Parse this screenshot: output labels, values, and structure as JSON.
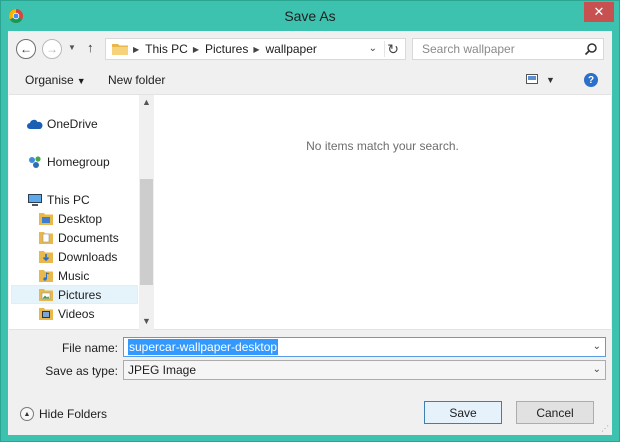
{
  "window": {
    "title": "Save As",
    "close_glyph": "✕"
  },
  "address": {
    "crumbs": [
      "This PC",
      "Pictures",
      "wallpaper"
    ],
    "search_placeholder": "Search wallpaper"
  },
  "toolbar": {
    "organise_label": "Organise",
    "new_folder_label": "New folder"
  },
  "nav": {
    "items": [
      {
        "label": "OneDrive",
        "icon": "cloud-icon"
      },
      {
        "label": "Homegroup",
        "icon": "homegroup-icon"
      },
      {
        "label": "This PC",
        "icon": "computer-icon"
      },
      {
        "label": "Desktop",
        "icon": "desktop-folder-icon"
      },
      {
        "label": "Documents",
        "icon": "documents-folder-icon"
      },
      {
        "label": "Downloads",
        "icon": "downloads-folder-icon"
      },
      {
        "label": "Music",
        "icon": "music-folder-icon"
      },
      {
        "label": "Pictures",
        "icon": "pictures-folder-icon"
      },
      {
        "label": "Videos",
        "icon": "videos-folder-icon"
      }
    ],
    "selected": "Pictures"
  },
  "files": {
    "empty_message": "No items match your search."
  },
  "form": {
    "file_name_label": "File name:",
    "file_name_value": "supercar-wallpaper-desktop",
    "save_type_label": "Save as type:",
    "save_type_value": "JPEG Image"
  },
  "footer": {
    "hide_folders_label": "Hide Folders",
    "save_label": "Save",
    "cancel_label": "Cancel"
  },
  "colors": {
    "accent": "#3ec2b0",
    "close": "#c75050",
    "selection": "#3399ff",
    "nav_selected": "#e5f3fb"
  }
}
